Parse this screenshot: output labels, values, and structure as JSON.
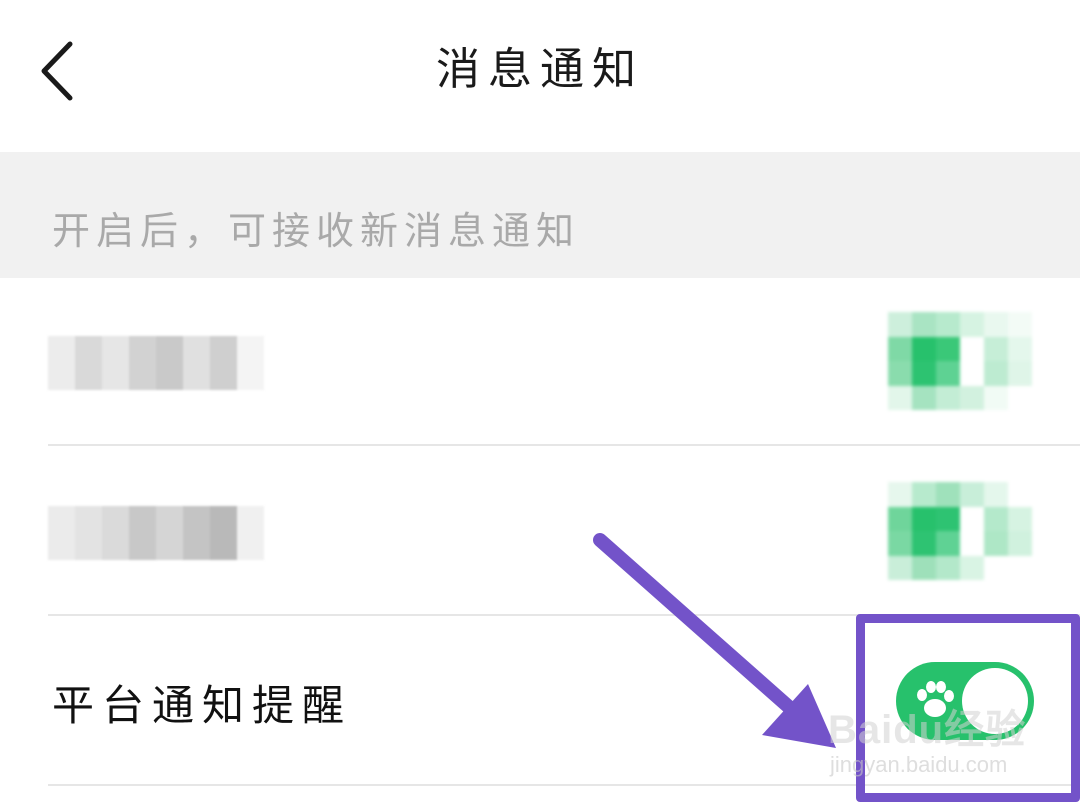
{
  "header": {
    "title": "消息通知",
    "back_icon": "chevron-left-icon"
  },
  "hint": {
    "text": "开启后，可接收新消息通知"
  },
  "rows": [
    {
      "label": "",
      "label_obscured": true,
      "toggle_obscured": true
    },
    {
      "label": "",
      "label_obscured": true,
      "toggle_obscured": true
    },
    {
      "label": "平台通知提醒",
      "toggle_on": true,
      "toggle_icon": "paw-icon"
    }
  ],
  "annotation": {
    "highlight_color": "#7353c9",
    "arrow_color": "#7353c9"
  },
  "watermark": {
    "brand": "Baidu经验",
    "url": "jingyan.baidu.com"
  },
  "colors": {
    "accent_green": "#27c16c",
    "hint_bg": "#f1f1f1",
    "hint_text": "#a9a9a9"
  }
}
